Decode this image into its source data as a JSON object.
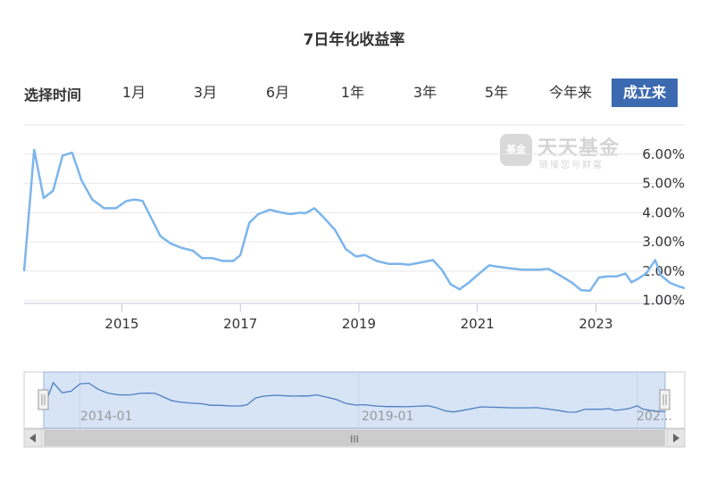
{
  "title": "7日年化收益率",
  "range_selector": {
    "label": "选择时间",
    "buttons": [
      {
        "label": "1月",
        "active": false
      },
      {
        "label": "3月",
        "active": false
      },
      {
        "label": "6月",
        "active": false
      },
      {
        "label": "1年",
        "active": false
      },
      {
        "label": "3年",
        "active": false
      },
      {
        "label": "5年",
        "active": false
      },
      {
        "label": "今年来",
        "active": false
      },
      {
        "label": "成立来",
        "active": true
      }
    ]
  },
  "watermark": {
    "badge": "基金",
    "title": "天天基金",
    "subtitle": "链接您与财富"
  },
  "colors": {
    "line": "#7cb5ec",
    "active": "#3c6ab0",
    "navigator_fill": "#d6e4f6"
  },
  "chart_data": {
    "type": "line",
    "y_tick_labels": [
      "1.00%",
      "2.00%",
      "3.00%",
      "4.00%",
      "5.00%",
      "6.00%"
    ],
    "y_ticks": [
      1,
      2,
      3,
      4,
      5,
      6
    ],
    "x_tick_labels": [
      "2015",
      "2017",
      "2019",
      "2021",
      "2023"
    ],
    "x_ticks": [
      2015.0,
      2017.0,
      2019.0,
      2021.0,
      2023.0
    ],
    "ylim": [
      0.9,
      7.0
    ],
    "xlim": [
      2013.35,
      2024.5
    ],
    "grid": true,
    "series": [
      {
        "x": [
          2013.35,
          2013.52,
          2013.68,
          2013.84,
          2014.0,
          2014.16,
          2014.32,
          2014.5,
          2014.7,
          2014.9,
          2015.08,
          2015.22,
          2015.35,
          2015.5,
          2015.65,
          2015.82,
          2016.0,
          2016.2,
          2016.35,
          2016.52,
          2016.7,
          2016.88,
          2017.0,
          2017.15,
          2017.3,
          2017.5,
          2017.7,
          2017.85,
          2018.0,
          2018.1,
          2018.25,
          2018.4,
          2018.6,
          2018.78,
          2018.95,
          2019.1,
          2019.3,
          2019.5,
          2019.7,
          2019.85,
          2020.05,
          2020.25,
          2020.4,
          2020.55,
          2020.7,
          2020.85,
          2021.05,
          2021.2,
          2021.35,
          2021.55,
          2021.75,
          2021.95,
          2022.05,
          2022.2,
          2022.4,
          2022.6,
          2022.75,
          2022.9,
          2023.05,
          2023.2,
          2023.35,
          2023.5,
          2023.6,
          2023.72,
          2023.85,
          2024.0,
          2024.1,
          2024.25,
          2024.4,
          2024.5
        ],
        "y": [
          2.0,
          6.15,
          4.5,
          4.75,
          5.95,
          6.05,
          5.1,
          4.45,
          4.15,
          4.15,
          4.4,
          4.45,
          4.4,
          3.8,
          3.2,
          2.95,
          2.8,
          2.7,
          2.45,
          2.45,
          2.35,
          2.35,
          2.55,
          3.65,
          3.95,
          4.1,
          4.0,
          3.95,
          4.0,
          3.98,
          4.15,
          3.85,
          3.4,
          2.75,
          2.5,
          2.55,
          2.35,
          2.25,
          2.25,
          2.22,
          2.3,
          2.38,
          2.05,
          1.55,
          1.38,
          1.6,
          1.95,
          2.2,
          2.15,
          2.1,
          2.05,
          2.05,
          2.05,
          2.08,
          1.85,
          1.6,
          1.35,
          1.33,
          1.78,
          1.82,
          1.82,
          1.92,
          1.62,
          1.75,
          1.92,
          2.38,
          1.85,
          1.6,
          1.48,
          1.42
        ]
      }
    ]
  },
  "navigator": {
    "tick_labels": [
      "2014-01",
      "2019-01",
      "202..."
    ],
    "scrollbar_grip": "III"
  }
}
